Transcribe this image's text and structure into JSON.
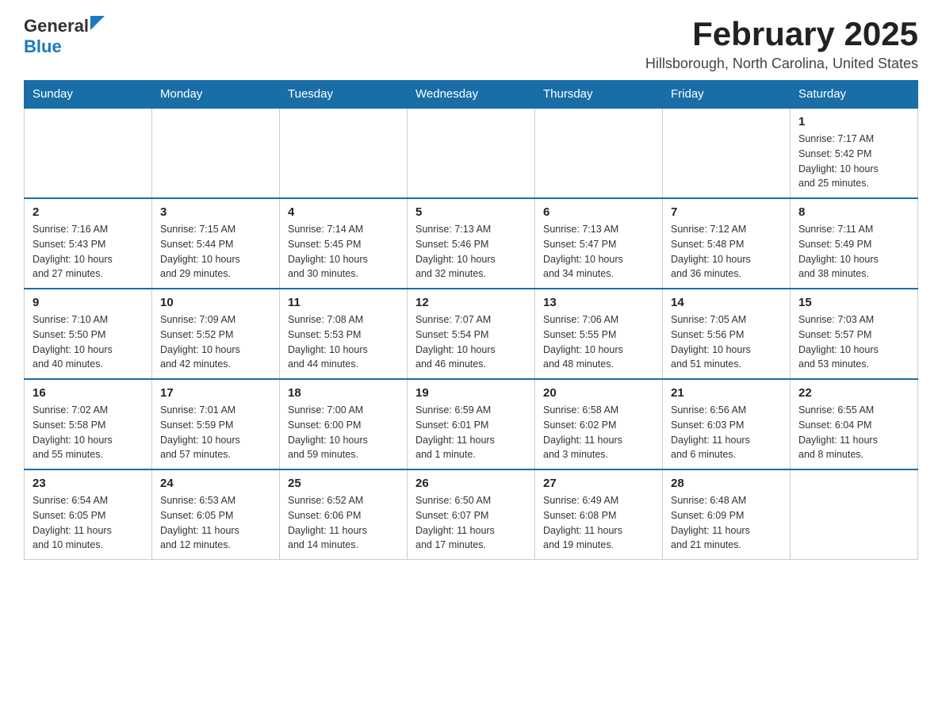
{
  "header": {
    "logo_general": "General",
    "logo_blue": "Blue",
    "month_title": "February 2025",
    "location": "Hillsborough, North Carolina, United States"
  },
  "weekdays": [
    "Sunday",
    "Monday",
    "Tuesday",
    "Wednesday",
    "Thursday",
    "Friday",
    "Saturday"
  ],
  "weeks": [
    [
      {
        "day": "",
        "info": ""
      },
      {
        "day": "",
        "info": ""
      },
      {
        "day": "",
        "info": ""
      },
      {
        "day": "",
        "info": ""
      },
      {
        "day": "",
        "info": ""
      },
      {
        "day": "",
        "info": ""
      },
      {
        "day": "1",
        "info": "Sunrise: 7:17 AM\nSunset: 5:42 PM\nDaylight: 10 hours\nand 25 minutes."
      }
    ],
    [
      {
        "day": "2",
        "info": "Sunrise: 7:16 AM\nSunset: 5:43 PM\nDaylight: 10 hours\nand 27 minutes."
      },
      {
        "day": "3",
        "info": "Sunrise: 7:15 AM\nSunset: 5:44 PM\nDaylight: 10 hours\nand 29 minutes."
      },
      {
        "day": "4",
        "info": "Sunrise: 7:14 AM\nSunset: 5:45 PM\nDaylight: 10 hours\nand 30 minutes."
      },
      {
        "day": "5",
        "info": "Sunrise: 7:13 AM\nSunset: 5:46 PM\nDaylight: 10 hours\nand 32 minutes."
      },
      {
        "day": "6",
        "info": "Sunrise: 7:13 AM\nSunset: 5:47 PM\nDaylight: 10 hours\nand 34 minutes."
      },
      {
        "day": "7",
        "info": "Sunrise: 7:12 AM\nSunset: 5:48 PM\nDaylight: 10 hours\nand 36 minutes."
      },
      {
        "day": "8",
        "info": "Sunrise: 7:11 AM\nSunset: 5:49 PM\nDaylight: 10 hours\nand 38 minutes."
      }
    ],
    [
      {
        "day": "9",
        "info": "Sunrise: 7:10 AM\nSunset: 5:50 PM\nDaylight: 10 hours\nand 40 minutes."
      },
      {
        "day": "10",
        "info": "Sunrise: 7:09 AM\nSunset: 5:52 PM\nDaylight: 10 hours\nand 42 minutes."
      },
      {
        "day": "11",
        "info": "Sunrise: 7:08 AM\nSunset: 5:53 PM\nDaylight: 10 hours\nand 44 minutes."
      },
      {
        "day": "12",
        "info": "Sunrise: 7:07 AM\nSunset: 5:54 PM\nDaylight: 10 hours\nand 46 minutes."
      },
      {
        "day": "13",
        "info": "Sunrise: 7:06 AM\nSunset: 5:55 PM\nDaylight: 10 hours\nand 48 minutes."
      },
      {
        "day": "14",
        "info": "Sunrise: 7:05 AM\nSunset: 5:56 PM\nDaylight: 10 hours\nand 51 minutes."
      },
      {
        "day": "15",
        "info": "Sunrise: 7:03 AM\nSunset: 5:57 PM\nDaylight: 10 hours\nand 53 minutes."
      }
    ],
    [
      {
        "day": "16",
        "info": "Sunrise: 7:02 AM\nSunset: 5:58 PM\nDaylight: 10 hours\nand 55 minutes."
      },
      {
        "day": "17",
        "info": "Sunrise: 7:01 AM\nSunset: 5:59 PM\nDaylight: 10 hours\nand 57 minutes."
      },
      {
        "day": "18",
        "info": "Sunrise: 7:00 AM\nSunset: 6:00 PM\nDaylight: 10 hours\nand 59 minutes."
      },
      {
        "day": "19",
        "info": "Sunrise: 6:59 AM\nSunset: 6:01 PM\nDaylight: 11 hours\nand 1 minute."
      },
      {
        "day": "20",
        "info": "Sunrise: 6:58 AM\nSunset: 6:02 PM\nDaylight: 11 hours\nand 3 minutes."
      },
      {
        "day": "21",
        "info": "Sunrise: 6:56 AM\nSunset: 6:03 PM\nDaylight: 11 hours\nand 6 minutes."
      },
      {
        "day": "22",
        "info": "Sunrise: 6:55 AM\nSunset: 6:04 PM\nDaylight: 11 hours\nand 8 minutes."
      }
    ],
    [
      {
        "day": "23",
        "info": "Sunrise: 6:54 AM\nSunset: 6:05 PM\nDaylight: 11 hours\nand 10 minutes."
      },
      {
        "day": "24",
        "info": "Sunrise: 6:53 AM\nSunset: 6:05 PM\nDaylight: 11 hours\nand 12 minutes."
      },
      {
        "day": "25",
        "info": "Sunrise: 6:52 AM\nSunset: 6:06 PM\nDaylight: 11 hours\nand 14 minutes."
      },
      {
        "day": "26",
        "info": "Sunrise: 6:50 AM\nSunset: 6:07 PM\nDaylight: 11 hours\nand 17 minutes."
      },
      {
        "day": "27",
        "info": "Sunrise: 6:49 AM\nSunset: 6:08 PM\nDaylight: 11 hours\nand 19 minutes."
      },
      {
        "day": "28",
        "info": "Sunrise: 6:48 AM\nSunset: 6:09 PM\nDaylight: 11 hours\nand 21 minutes."
      },
      {
        "day": "",
        "info": ""
      }
    ]
  ]
}
